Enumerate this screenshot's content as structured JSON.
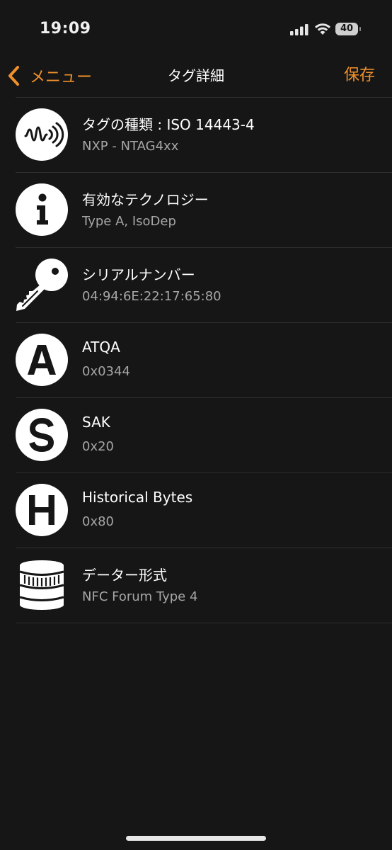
{
  "status_bar": {
    "time": "19:09",
    "battery": "40"
  },
  "nav": {
    "back_label": "メニュー",
    "title": "タグ詳細",
    "save_label": "保存"
  },
  "items": [
    {
      "icon": "nfc-tag-icon",
      "title": "タグの種類 : ISO 14443-4",
      "value": "NXP - NTAG4xx"
    },
    {
      "icon": "info-icon",
      "title": "有効なテクノロジー",
      "value": "Type A, IsoDep"
    },
    {
      "icon": "key-icon",
      "title": "シリアルナンバー",
      "value": "04:94:6E:22:17:65:80"
    },
    {
      "icon": "letter-a-icon",
      "title": "ATQA",
      "value": "0x0344"
    },
    {
      "icon": "letter-s-icon",
      "title": "SAK",
      "value": "0x20"
    },
    {
      "icon": "letter-h-icon",
      "title": "Historical Bytes",
      "value": "0x80"
    },
    {
      "icon": "database-icon",
      "title": "データー形式",
      "value": "NFC Forum Type 4"
    }
  ],
  "colors": {
    "accent": "#f0912a",
    "background": "#161616",
    "secondary_text": "#a6a6a6"
  }
}
